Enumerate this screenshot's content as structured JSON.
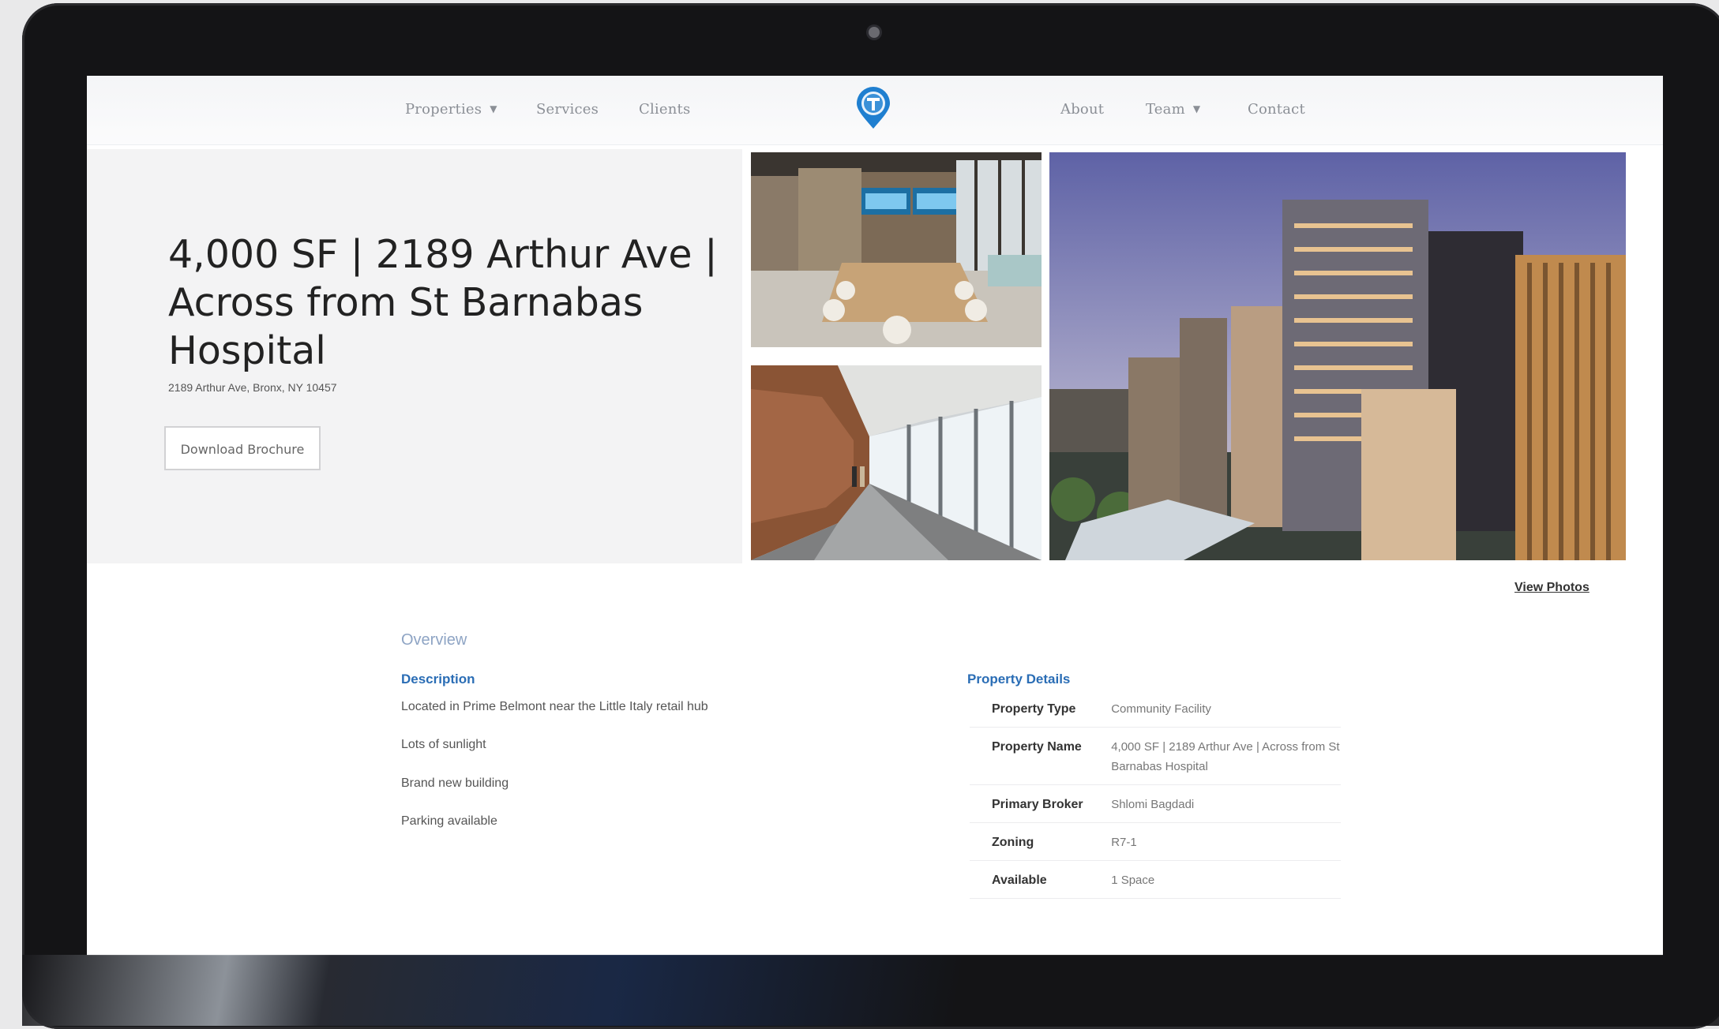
{
  "nav": {
    "left_items": [
      {
        "label": "Properties",
        "has_dropdown": true
      },
      {
        "label": "Services",
        "has_dropdown": false
      },
      {
        "label": "Clients",
        "has_dropdown": false
      }
    ],
    "right_items": [
      {
        "label": "About",
        "has_dropdown": false
      },
      {
        "label": "Team",
        "has_dropdown": true
      },
      {
        "label": "Contact",
        "has_dropdown": false
      }
    ],
    "logo_icon": "map-pin-logo-icon",
    "dropdown_icon": "chevron-down-icon"
  },
  "hero": {
    "title": "4,000 SF | 2189 Arthur Ave | Across from St Barnabas Hospital",
    "address": "2189 Arthur Ave, Bronx, NY 10457",
    "brochure_button": "Download Brochure",
    "view_photos_link": "View Photos"
  },
  "overview": {
    "heading": "Overview",
    "description_heading": "Description",
    "description_lines": [
      "Located in Prime Belmont near the Little Italy retail hub",
      "Lots of sunlight",
      "Brand new building",
      "Parking available"
    ],
    "details_heading": "Property Details",
    "details": [
      {
        "key": "Property Type",
        "value": "Community Facility"
      },
      {
        "key": "Property Name",
        "value": "4,000 SF | 2189 Arthur Ave | Across from St Barnabas Hospital"
      },
      {
        "key": "Primary Broker",
        "value": "Shlomi Bagdadi"
      },
      {
        "key": "Zoning",
        "value": "R7-1"
      },
      {
        "key": "Available",
        "value": "1 Space"
      }
    ]
  },
  "colors": {
    "accent_blue": "#2a6db5",
    "overview_label": "#8ea4c4",
    "logo_blue": "#1f7fd0"
  }
}
